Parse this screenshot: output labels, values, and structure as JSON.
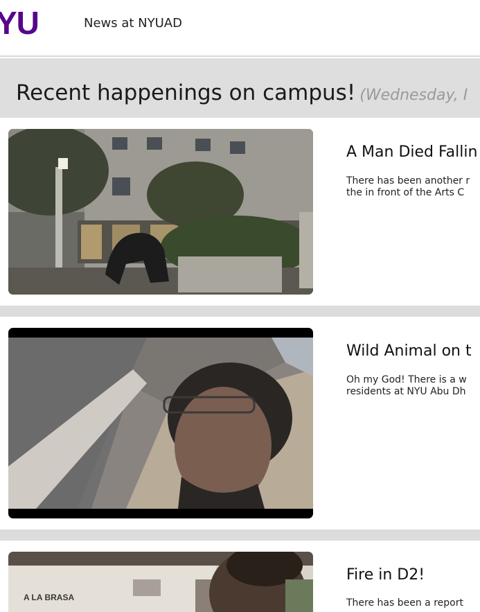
{
  "header": {
    "logo_text": "YU",
    "site_title": "News at NYUAD"
  },
  "banner": {
    "title": "Recent happenings on campus!",
    "date_text": "(Wednesday, I"
  },
  "articles": [
    {
      "title": "A Man Died Fallin",
      "text_line1": "There has been another r",
      "text_line2": "the in front of the Arts C"
    },
    {
      "title": "Wild Animal on t",
      "text_line1": "Oh my God! There is a w",
      "text_line2": "residents at NYU Abu Dh"
    },
    {
      "title": "Fire in D2!",
      "text_line1": "There has been a report"
    }
  ],
  "colors": {
    "brand": "#57068c",
    "banner_bg": "#dedede",
    "date_text": "#9a9a9a"
  },
  "icons": {
    "logo": "nyu-wordmark"
  }
}
